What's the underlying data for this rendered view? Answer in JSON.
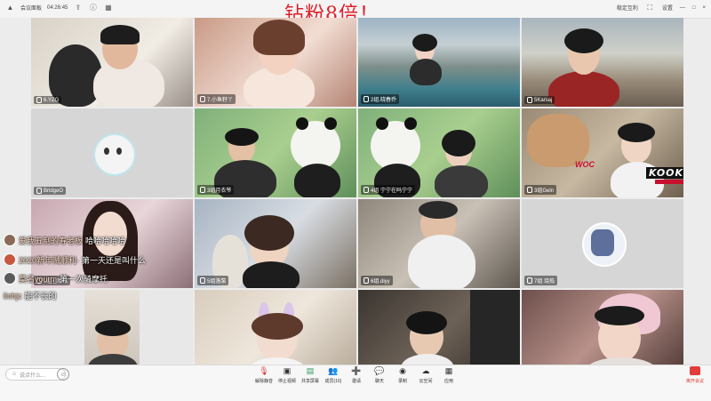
{
  "topbar": {
    "app_name": "会议面板",
    "time": "04:26:45",
    "right_items": [
      "设置",
      "—",
      "□",
      "×"
    ],
    "quality_label": "稳定互利"
  },
  "overlay_title": "钻粉8倍！",
  "tiles": [
    {
      "label": "6.YZG"
    },
    {
      "label": "7.小鱼籽丫"
    },
    {
      "label": "2组.晓春乔"
    },
    {
      "label": "5Karsaj"
    },
    {
      "label": "BridgeO"
    },
    {
      "label": "3组月衣爷"
    },
    {
      "label": "4组 宁宁在吗宁宁"
    },
    {
      "label": "3组Geln"
    },
    {
      "label": "1组七哈哈"
    },
    {
      "label": "5组洛泵"
    },
    {
      "label": "6组.diyy"
    },
    {
      "label": "7组 烧捣"
    },
    {
      "label": ""
    },
    {
      "label": ""
    },
    {
      "label": ""
    },
    {
      "label": ""
    }
  ],
  "overlay_badge": {
    "team": "WOC",
    "text": "KOOK631366"
  },
  "danmu": [
    {
      "nick": "爱我五制的寿老板",
      "text": "哈哈哈哈哈"
    },
    {
      "nick": "2020新年贼顺利·",
      "text": "第一天还是叫什么"
    },
    {
      "nick": "莫名yourm",
      "text": "第一次骑摩托"
    },
    {
      "nick": "linhjc",
      "text": "能不长的"
    }
  ],
  "bottombar": {
    "chat_placeholder": "说点什么...",
    "tools": [
      {
        "label": "解除静音",
        "icon": "mic-icon"
      },
      {
        "label": "停止视频",
        "icon": "camera-icon"
      },
      {
        "label": "共享屏幕",
        "icon": "screen-share-icon"
      },
      {
        "label": "成员(16)",
        "icon": "members-icon"
      },
      {
        "label": "邀请",
        "icon": "invite-icon"
      },
      {
        "label": "聊天",
        "icon": "chat-icon"
      },
      {
        "label": "录制",
        "icon": "record-icon"
      },
      {
        "label": "云空间",
        "icon": "cloud-icon"
      },
      {
        "label": "应用",
        "icon": "apps-icon"
      }
    ],
    "leave_label": "离开会议"
  },
  "colors": {
    "accent_red": "#e0202a",
    "leave_red": "#e23b3b"
  }
}
